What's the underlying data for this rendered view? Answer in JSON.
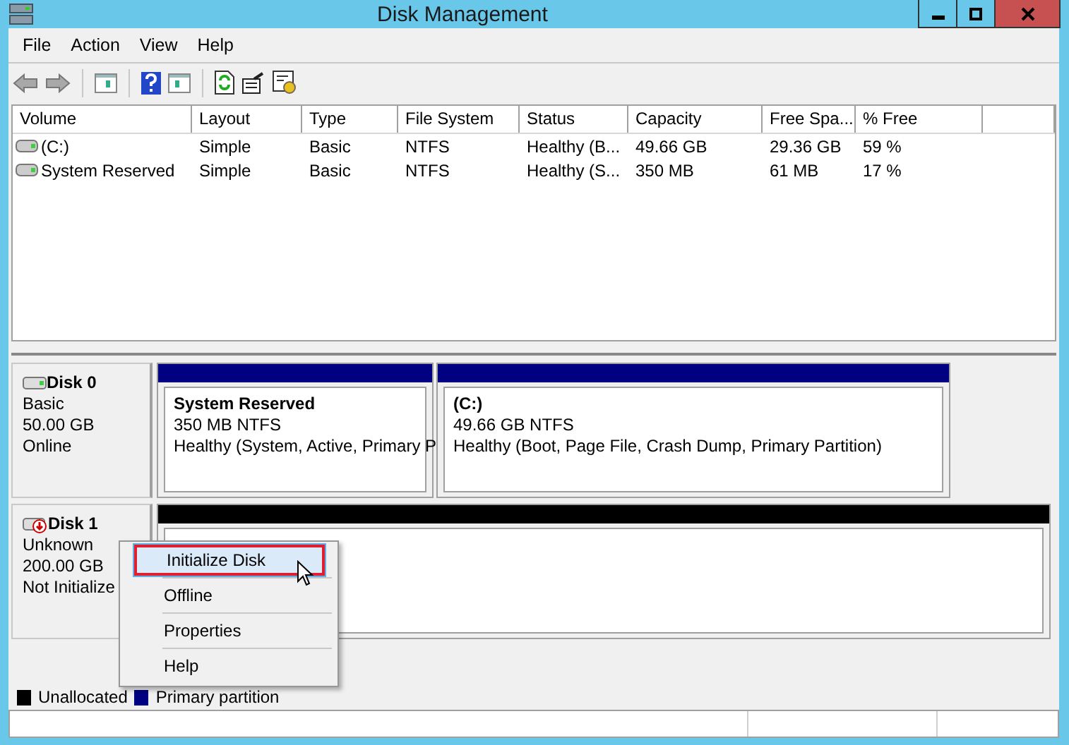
{
  "window": {
    "title": "Disk Management"
  },
  "menu": [
    "File",
    "Action",
    "View",
    "Help"
  ],
  "volume_table": {
    "columns": [
      "Volume",
      "Layout",
      "Type",
      "File System",
      "Status",
      "Capacity",
      "Free Spa...",
      "% Free"
    ],
    "rows": [
      {
        "cells": [
          "(C:)",
          "Simple",
          "Basic",
          "NTFS",
          "Healthy (B...",
          "49.66 GB",
          "29.36 GB",
          "59 %"
        ]
      },
      {
        "cells": [
          "System Reserved",
          "Simple",
          "Basic",
          "NTFS",
          "Healthy (S...",
          "350 MB",
          "61 MB",
          "17 %"
        ]
      }
    ]
  },
  "disks": [
    {
      "name": "Disk 0",
      "kind": "online",
      "lines": [
        "Basic",
        "50.00 GB",
        "Online"
      ],
      "partitions": [
        {
          "kind": "primary",
          "name": "System Reserved",
          "size": "350 MB NTFS",
          "status": "Healthy (System, Active, Primary P"
        },
        {
          "kind": "primary",
          "name": "(C:)",
          "size": "49.66 GB NTFS",
          "status": "Healthy (Boot, Page File, Crash Dump, Primary Partition)"
        }
      ]
    },
    {
      "name": "Disk 1",
      "kind": "not_initialized",
      "lines": [
        "Unknown",
        "200.00 GB",
        "Not Initialize"
      ],
      "partitions": [
        {
          "kind": "unallocated"
        }
      ]
    }
  ],
  "legend": [
    {
      "label": "Unallocated",
      "color": "#000000"
    },
    {
      "label": "Primary partition",
      "color": "#000080"
    }
  ],
  "context_menu": [
    {
      "label": "Initialize Disk",
      "selected": true
    },
    {
      "label": "Offline",
      "selected": false
    },
    {
      "label": "Properties",
      "selected": false
    },
    {
      "label": "Help",
      "selected": false
    }
  ]
}
